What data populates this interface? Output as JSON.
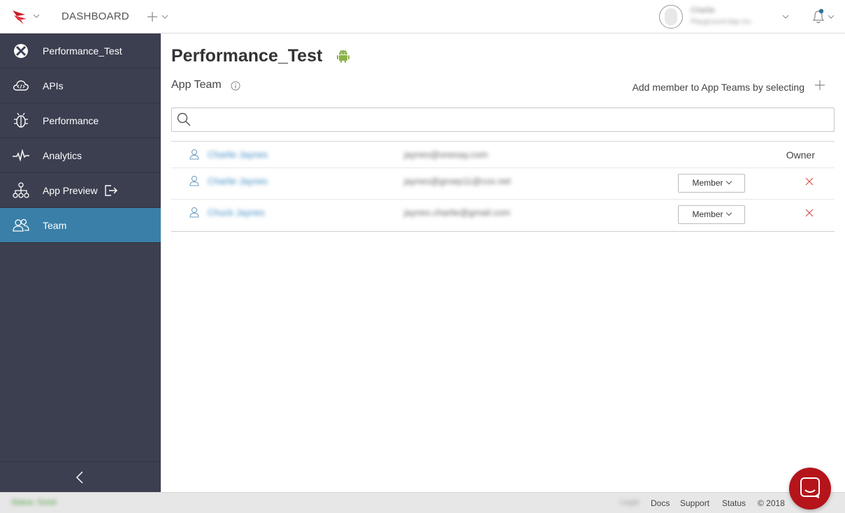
{
  "header": {
    "nav_label": "DASHBOARD",
    "user_name": "Charlie",
    "user_org": "Playground App Inc"
  },
  "sidebar": {
    "items": [
      {
        "label": "Performance_Test",
        "icon": "app-icon"
      },
      {
        "label": "APIs",
        "icon": "cloud-code-icon"
      },
      {
        "label": "Performance",
        "icon": "bug-icon"
      },
      {
        "label": "Analytics",
        "icon": "pulse-icon"
      },
      {
        "label": "App Preview",
        "icon": "sitemap-icon"
      },
      {
        "label": "Team",
        "icon": "users-icon"
      }
    ],
    "active_item": "Team"
  },
  "main": {
    "title": "Performance_Test",
    "section_title": "App Team",
    "add_member_label": "Add member to App Teams by selecting",
    "search_placeholder": "",
    "members": [
      {
        "name": "Charlie Jaynes",
        "email": "jaynes@onesay.com",
        "role": "Owner"
      },
      {
        "name": "Charlie Jaynes",
        "email": "jaynes@groep11@cox.net",
        "role": "Member"
      },
      {
        "name": "Chuck Jaynes",
        "email": "jaynes.charlie@gmail.com",
        "role": "Member"
      }
    ]
  },
  "footer": {
    "status_label": "Status: Good",
    "blurred_label": "Legal",
    "docs": "Docs",
    "support": "Support",
    "status": "Status",
    "copyright": "© 2018"
  },
  "colors": {
    "sidebar_bg": "#3b3f50",
    "active_bg": "#3a7fa8",
    "brand_red": "#b5141b",
    "android_green": "#8bb04a"
  }
}
